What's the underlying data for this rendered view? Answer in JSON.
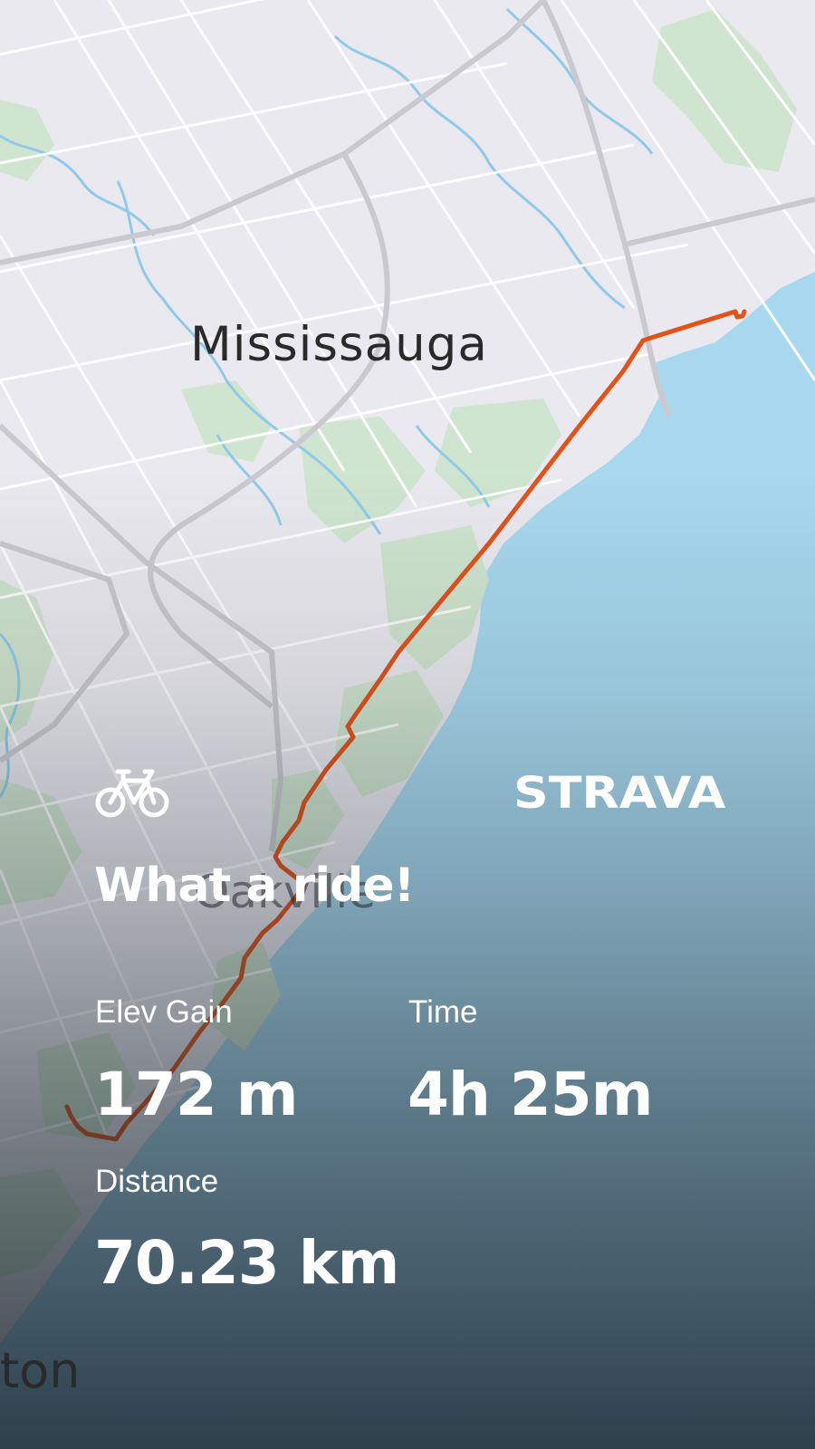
{
  "map": {
    "labels": {
      "city_primary": "Mississauga",
      "city_secondary": "Oakville",
      "city_partial": "ton"
    },
    "colors": {
      "land": "#e9e9ef",
      "water": "#a7d8ee",
      "park": "#cfe5cf",
      "road": "#ffffff",
      "highway": "#c9c9cf",
      "river": "#8fcbe8",
      "route": "#e2531a"
    }
  },
  "activity": {
    "type_icon": "bike-icon",
    "brand": "STRAVA",
    "headline": "What a ride!",
    "stats": [
      {
        "label": "Elev Gain",
        "value": "172 m"
      },
      {
        "label": "Time",
        "value": "4h 25m"
      },
      {
        "label": "Distance",
        "value": "70.23 km"
      }
    ]
  }
}
